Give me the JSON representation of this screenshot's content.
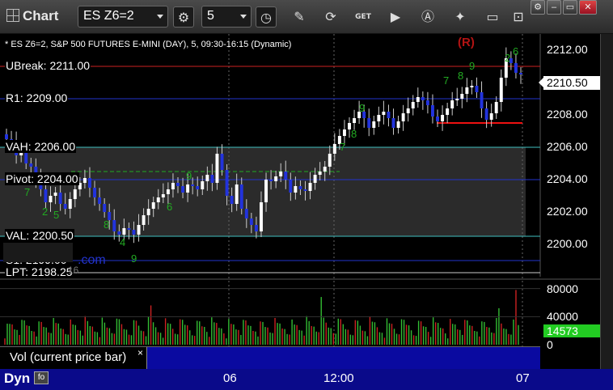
{
  "toolbar": {
    "title": "Chart",
    "symbol": "ES Z6=2",
    "interval": "5",
    "icons": [
      "settings-icon",
      "clock-icon",
      "pencil-icon",
      "refresh-icon",
      "order-icon",
      "play-icon",
      "analysis-icon",
      "tools-icon",
      "message-icon",
      "lock-icon",
      "minimize-icon",
      "close-icon"
    ],
    "order_label": "GET"
  },
  "chart": {
    "description": "* ES Z6=2, S&P 500 FUTURES E-MINI (DAY), 5, 09:30-16:15 (Dynamic)",
    "r_mark": "(R)",
    "current_price": "2210.50",
    "levels": [
      {
        "label": "UBreak: 2211.00",
        "price": 2211.0,
        "color": "#cc2222"
      },
      {
        "label": "R1: 2209.00",
        "price": 2209.0,
        "color": "#2233cc"
      },
      {
        "label": "VAH: 2206.00",
        "price": 2206.0,
        "color": "#40c0c0"
      },
      {
        "label": "Pivot: 2204.00",
        "price": 2204.0,
        "color": "#2233cc"
      },
      {
        "label": "VAL: 2200.50",
        "price": 2200.5,
        "color": "#40c0c0"
      },
      {
        "label": "S1: 2199.00",
        "price": 2199.0,
        "color": "#2233cc"
      },
      {
        "label": "LPT: 2198.25",
        "price": 2198.25,
        "color": "#cccccc"
      }
    ],
    "y_ticks": [
      "2212.00",
      "2210.00",
      "2208.00",
      "2206.00",
      "2204.00",
      "2202.00",
      "2200.00"
    ],
    "y_range": [
      2198.0,
      2213.0
    ],
    "support_price": 2207.5,
    "ghost_text": ".com",
    "ghost_num": "16"
  },
  "volume": {
    "label": "Vol (current price bar)",
    "close": "×",
    "current": "14573",
    "ticks": [
      "80000",
      "40000",
      "0"
    ],
    "max": 90000
  },
  "x_axis": {
    "ticks": [
      "06",
      "12:00",
      "07"
    ],
    "footer": "Dyn",
    "footer_icon": "fo"
  },
  "colors": {
    "up": "#ffffff",
    "down": "#2233dd",
    "vol_up": "#33bb33",
    "vol_down": "#cc2222",
    "td": "#22aa22"
  }
}
